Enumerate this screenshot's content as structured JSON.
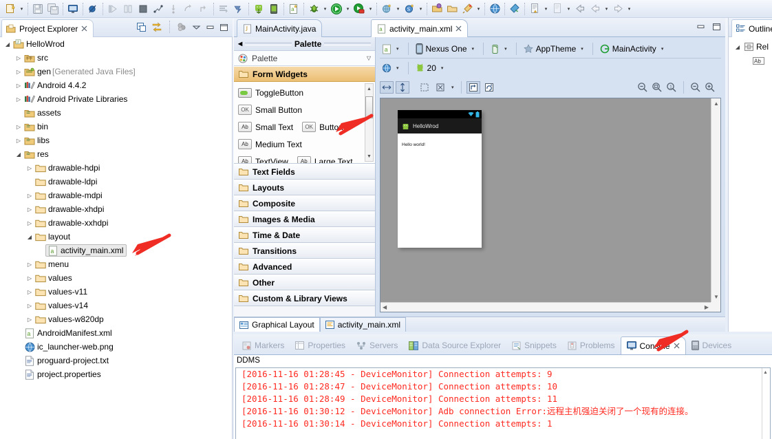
{
  "toolbar": {
    "items": [
      {
        "name": "new-wizard-icon",
        "glyph": "new",
        "dropdown": true
      },
      {
        "name": "save-icon",
        "glyph": "save",
        "dropdown": false
      },
      {
        "name": "save-all-icon",
        "glyph": "saveall",
        "dropdown": false
      },
      {
        "name": "console-icon",
        "glyph": "console",
        "dropdown": false
      },
      {
        "name": "skip-breakpoints-icon",
        "glyph": "nobreak",
        "dropdown": false
      },
      {
        "name": "resume-icon",
        "glyph": "resume",
        "dropdown": false
      },
      {
        "name": "suspend-icon",
        "glyph": "suspend",
        "dropdown": false
      },
      {
        "name": "terminate-icon",
        "glyph": "terminate",
        "dropdown": false
      },
      {
        "name": "disconnect-icon",
        "glyph": "disconnect",
        "dropdown": false
      },
      {
        "name": "step-into-icon",
        "glyph": "stepinto",
        "dropdown": false
      },
      {
        "name": "step-over-icon",
        "glyph": "stepover",
        "dropdown": false
      },
      {
        "name": "step-return-icon",
        "glyph": "stepreturn",
        "dropdown": false
      },
      {
        "name": "next-annotation-icon",
        "glyph": "nextann",
        "dropdown": false
      },
      {
        "name": "android-sdk-manager-icon",
        "glyph": "sdkmgr",
        "dropdown": false
      },
      {
        "name": "android-virtual-device-manager-icon",
        "glyph": "avdmgr",
        "dropdown": false
      },
      {
        "name": "new-android-xml-file-icon",
        "glyph": "newxml",
        "dropdown": false
      },
      {
        "name": "debug-icon",
        "glyph": "debug",
        "dropdown": true
      },
      {
        "name": "run-icon",
        "glyph": "run",
        "dropdown": true
      },
      {
        "name": "run-external-tools-icon",
        "glyph": "exttools",
        "dropdown": true
      },
      {
        "name": "new-java-package-icon",
        "glyph": "newpkg",
        "dropdown": true
      },
      {
        "name": "new-java-class-icon",
        "glyph": "newclass",
        "dropdown": true
      },
      {
        "name": "open-type-icon",
        "glyph": "opentype",
        "dropdown": false
      },
      {
        "name": "open-task-icon",
        "glyph": "opentask",
        "dropdown": false
      },
      {
        "name": "search-icon",
        "glyph": "search",
        "dropdown": true
      },
      {
        "name": "open-web-browser-icon",
        "glyph": "browser",
        "dropdown": false
      },
      {
        "name": "run-last-tool-icon",
        "glyph": "runlast",
        "dropdown": false
      },
      {
        "name": "previous-edit-icon",
        "glyph": "prevedit",
        "dropdown": true
      },
      {
        "name": "next-edit-icon",
        "glyph": "nextedit",
        "dropdown": true
      },
      {
        "name": "back-icon",
        "glyph": "back",
        "dropdown": false
      },
      {
        "name": "back-history-icon",
        "glyph": "backhist",
        "dropdown": true
      },
      {
        "name": "forward-icon",
        "glyph": "forward",
        "dropdown": true
      }
    ]
  },
  "project_explorer": {
    "tab_label": "Project Explorer",
    "tools": [
      "collapse-all",
      "link-with-editor",
      "view-menu",
      "minimize",
      "maximize"
    ],
    "tree": [
      {
        "label": "HelloWrod",
        "indent": 0,
        "twist": "open",
        "icon": "project",
        "dim": ""
      },
      {
        "label": "src",
        "indent": 1,
        "twist": "closed",
        "icon": "srcfolder",
        "dim": ""
      },
      {
        "label": "gen",
        "indent": 1,
        "twist": "closed",
        "icon": "genfolder",
        "dim": "[Generated Java Files]"
      },
      {
        "label": "Android 4.4.2",
        "indent": 1,
        "twist": "closed",
        "icon": "library",
        "dim": ""
      },
      {
        "label": "Android Private Libraries",
        "indent": 1,
        "twist": "closed",
        "icon": "library",
        "dim": ""
      },
      {
        "label": "assets",
        "indent": 1,
        "twist": "none",
        "icon": "resfolder",
        "dim": ""
      },
      {
        "label": "bin",
        "indent": 1,
        "twist": "closed",
        "icon": "resfolder",
        "dim": ""
      },
      {
        "label": "libs",
        "indent": 1,
        "twist": "closed",
        "icon": "resfolder",
        "dim": ""
      },
      {
        "label": "res",
        "indent": 1,
        "twist": "open",
        "icon": "resfolder",
        "dim": ""
      },
      {
        "label": "drawable-hdpi",
        "indent": 2,
        "twist": "closed",
        "icon": "folder",
        "dim": ""
      },
      {
        "label": "drawable-ldpi",
        "indent": 2,
        "twist": "none",
        "icon": "folder",
        "dim": ""
      },
      {
        "label": "drawable-mdpi",
        "indent": 2,
        "twist": "closed",
        "icon": "folder",
        "dim": ""
      },
      {
        "label": "drawable-xhdpi",
        "indent": 2,
        "twist": "closed",
        "icon": "folder",
        "dim": ""
      },
      {
        "label": "drawable-xxhdpi",
        "indent": 2,
        "twist": "closed",
        "icon": "folder",
        "dim": ""
      },
      {
        "label": "layout",
        "indent": 2,
        "twist": "open",
        "icon": "folder",
        "dim": ""
      },
      {
        "label": "activity_main.xml",
        "indent": 3,
        "twist": "none",
        "icon": "xml",
        "dim": "",
        "selected": true
      },
      {
        "label": "menu",
        "indent": 2,
        "twist": "closed",
        "icon": "folder",
        "dim": ""
      },
      {
        "label": "values",
        "indent": 2,
        "twist": "closed",
        "icon": "folder",
        "dim": ""
      },
      {
        "label": "values-v11",
        "indent": 2,
        "twist": "closed",
        "icon": "folder",
        "dim": ""
      },
      {
        "label": "values-v14",
        "indent": 2,
        "twist": "closed",
        "icon": "folder",
        "dim": ""
      },
      {
        "label": "values-w820dp",
        "indent": 2,
        "twist": "closed",
        "icon": "folder",
        "dim": ""
      },
      {
        "label": "AndroidManifest.xml",
        "indent": 1,
        "twist": "none",
        "icon": "xml",
        "dim": ""
      },
      {
        "label": "ic_launcher-web.png",
        "indent": 1,
        "twist": "none",
        "icon": "png",
        "dim": ""
      },
      {
        "label": "proguard-project.txt",
        "indent": 1,
        "twist": "none",
        "icon": "txt",
        "dim": ""
      },
      {
        "label": "project.properties",
        "indent": 1,
        "twist": "none",
        "icon": "txt",
        "dim": ""
      }
    ]
  },
  "editor": {
    "tabs": [
      {
        "label": "MainActivity.java",
        "icon": "java-file-icon",
        "active": false,
        "closable": false
      },
      {
        "label": "activity_main.xml",
        "icon": "android-xml-icon",
        "active": true,
        "closable": true
      }
    ],
    "window_buttons": [
      "minimize",
      "maximize"
    ],
    "bottom_tabs": [
      {
        "label": "Graphical Layout",
        "icon": "graphical-layout-icon",
        "active": true
      },
      {
        "label": "activity_main.xml",
        "icon": "xml-source-icon",
        "active": false
      }
    ]
  },
  "palette": {
    "title": "Palette",
    "collapse_icon": "collapse-left-icon",
    "selector_label": "Palette",
    "open_group": "Form Widgets",
    "items": [
      {
        "label": "TextView",
        "chip": "Ab",
        "chip_type": "ab"
      },
      {
        "label": "Large Text",
        "chip": "Ab",
        "chip_type": "ab"
      },
      {
        "label": "Medium Text",
        "chip": "Ab",
        "chip_type": "ab"
      },
      {
        "label": "Small Text",
        "chip": "Ab",
        "chip_type": "ab"
      },
      {
        "label": "Button",
        "chip": "OK",
        "chip_type": "ok"
      },
      {
        "label": "Small Button",
        "chip": "OK",
        "chip_type": "ok"
      },
      {
        "label": "ToggleButton",
        "chip": "",
        "chip_type": "toggle"
      }
    ],
    "groups": [
      "Text Fields",
      "Layouts",
      "Composite",
      "Images & Media",
      "Time & Date",
      "Transitions",
      "Advanced",
      "Other",
      "Custom & Library Views"
    ]
  },
  "design_toolbar": {
    "config_label": "",
    "device": "Nexus One",
    "orientation_icon": "portrait-icon",
    "theme": "AppTheme",
    "activity": "MainActivity",
    "locale_icon": "globe-icon",
    "api_level": "20",
    "buttons": [
      {
        "name": "fit-width-button",
        "glyph": "↔",
        "pressed": true
      },
      {
        "name": "fit-height-button",
        "glyph": "↕",
        "pressed": true
      },
      {
        "name": "show-outline-button",
        "glyph": "dots",
        "pressed": false
      },
      {
        "name": "distribute-button",
        "glyph": "expand",
        "pressed": false
      },
      {
        "name": "structure-button",
        "glyph": "struct",
        "pressed": true
      },
      {
        "name": "refresh-render-button",
        "glyph": "refresh",
        "pressed": false
      }
    ],
    "zoom_buttons": [
      {
        "name": "zoom-out-fit-button",
        "glyph": "zo"
      },
      {
        "name": "zoom-fit-button",
        "glyph": "zf"
      },
      {
        "name": "zoom-100-button",
        "glyph": "z1"
      },
      {
        "name": "zoom-minus-button",
        "glyph": "−"
      },
      {
        "name": "zoom-plus-button",
        "glyph": "+"
      }
    ]
  },
  "preview": {
    "app_title": "HelloWrod",
    "content_text": "Hello world!",
    "status_icons": [
      "wifi-icon",
      "battery-icon"
    ]
  },
  "outline": {
    "tab_label": "Outline",
    "tree": [
      {
        "label": "Rel",
        "indent": 0,
        "twist": "open",
        "icon": "relative-layout-icon"
      },
      {
        "label": "",
        "indent": 1,
        "twist": "none",
        "icon": "textview-icon"
      }
    ]
  },
  "console": {
    "tabs": [
      {
        "label": "Markers",
        "icon": "markers-icon",
        "active": false
      },
      {
        "label": "Properties",
        "icon": "properties-icon",
        "active": false
      },
      {
        "label": "Servers",
        "icon": "servers-icon",
        "active": false
      },
      {
        "label": "Data Source Explorer",
        "icon": "datasource-icon",
        "active": false
      },
      {
        "label": "Snippets",
        "icon": "snippets-icon",
        "active": false
      },
      {
        "label": "Problems",
        "icon": "problems-icon",
        "active": false
      },
      {
        "label": "Console",
        "icon": "console-icon",
        "active": true,
        "closable": true
      },
      {
        "label": "Devices",
        "icon": "devices-icon",
        "active": false
      }
    ],
    "source_label": "DDMS",
    "lines": [
      "[2016-11-16 01:28:45 - DeviceMonitor] Connection attempts: 9",
      "[2016-11-16 01:28:47 - DeviceMonitor] Connection attempts: 10",
      "[2016-11-16 01:28:49 - DeviceMonitor] Connection attempts: 11",
      "[2016-11-16 01:30:12 - DeviceMonitor] Adb connection Error:远程主机强迫关闭了一个现有的连接。",
      "[2016-11-16 01:30:14 - DeviceMonitor] Connection attempts: 1"
    ],
    "text_color": "#ff2a20"
  },
  "annotations": [
    {
      "name": "arrow-to-activity-main-xml",
      "color": "#ef2d24"
    },
    {
      "name": "arrow-to-button-palette-item",
      "color": "#ef2d24"
    },
    {
      "name": "arrow-to-console-tab",
      "color": "#ef2d24"
    }
  ]
}
